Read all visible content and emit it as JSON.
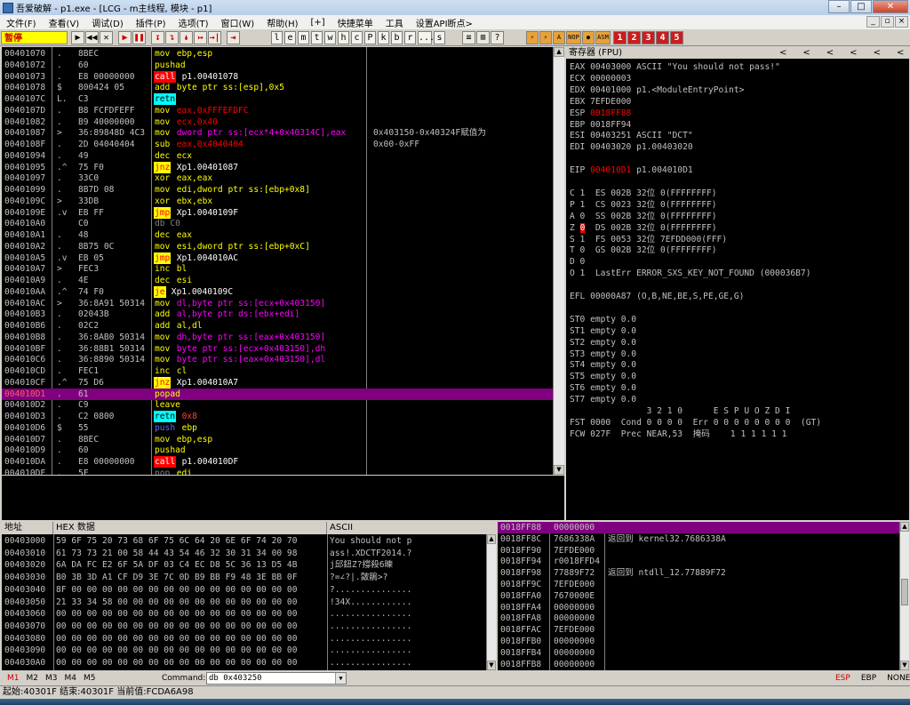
{
  "window": {
    "title": "吾爱破解 - p1.exe - [LCG - m主线程, 模块 - p1]",
    "btn_min": "–",
    "btn_max": "□",
    "btn_close": "✕"
  },
  "menu": {
    "items": [
      "文件(F)",
      "查看(V)",
      "调试(D)",
      "插件(P)",
      "选项(T)",
      "窗口(W)",
      "帮助(H)",
      "[+]",
      "快捷菜单",
      "工具",
      "设置API断点>"
    ],
    "mdi": [
      "_",
      "▫",
      "×"
    ]
  },
  "toolbar": {
    "status": "暂停",
    "buttons": [
      "▶",
      "◀◀",
      "✕",
      "▶",
      "❚❚",
      "↧",
      "↴",
      "↡",
      "↦",
      "→|",
      "⇥"
    ],
    "letters": [
      "l",
      "e",
      "m",
      "t",
      "w",
      "h",
      "c",
      "P",
      "k",
      "b",
      "r",
      "...",
      "s"
    ],
    "right_buttons": [
      "≡",
      "⊞",
      "?"
    ],
    "plugin_buttons": [
      "⚡",
      "⚡",
      "A",
      "NOP",
      "●",
      "ASM"
    ],
    "numbers": [
      "1",
      "2",
      "3",
      "4",
      "5"
    ]
  },
  "disasm": {
    "rows": [
      {
        "a": "00401070",
        "m": ".",
        "h": "8BEC",
        "i": "mov",
        "o": "ebp,esp",
        "ic": "norm",
        "oc": "norm",
        "c": ""
      },
      {
        "a": "00401072",
        "m": ".",
        "h": "60",
        "i": "pushad",
        "o": "",
        "ic": "norm",
        "oc": "norm",
        "c": ""
      },
      {
        "a": "00401073",
        "m": ".",
        "h": "E8 00000000",
        "i": "call",
        "o": "p1.00401078",
        "ic": "call",
        "oc": "norm",
        "c": ""
      },
      {
        "a": "00401078",
        "m": "$",
        "h": "800424 05",
        "i": "add",
        "o": "byte ptr ss:[esp],0x5",
        "ic": "norm",
        "oc": "norm",
        "c": ""
      },
      {
        "a": "0040107C",
        "m": "L.",
        "h": "C3",
        "i": "retn",
        "o": "",
        "ic": "ret",
        "oc": "norm",
        "c": ""
      },
      {
        "a": "0040107D",
        "m": ".",
        "h": "B8 FCFDFEFF",
        "i": "mov",
        "o": "eax,0xFFFEFDFC",
        "ic": "norm",
        "oc": "hex",
        "c": ""
      },
      {
        "a": "00401082",
        "m": ".",
        "h": "B9 40000000",
        "i": "mov",
        "o": "ecx,0x40",
        "ic": "norm",
        "oc": "hex",
        "c": ""
      },
      {
        "a": "00401087",
        "m": ">",
        "h": "36:89848D 4C3",
        "i": "mov",
        "o": "dword ptr ss:[ecx*4+0x40314C],eax",
        "ic": "norm",
        "oc": "mem",
        "c": "0x403150-0x40324F赋值为"
      },
      {
        "a": "0040108F",
        "m": ".",
        "h": "2D 04040404",
        "i": "sub",
        "o": "eax,0x4040404",
        "ic": "norm",
        "oc": "hex",
        "c": "0x00-0xFF"
      },
      {
        "a": "00401094",
        "m": ".",
        "h": "49",
        "i": "dec",
        "o": "ecx",
        "ic": "norm",
        "oc": "norm",
        "c": ""
      },
      {
        "a": "00401095",
        "m": ".^",
        "h": "75 F0",
        "i": "jnz",
        "o": "Xp1.00401087",
        "ic": "jcc",
        "oc": "norm",
        "c": ""
      },
      {
        "a": "00401097",
        "m": ".",
        "h": "33C0",
        "i": "xor",
        "o": "eax,eax",
        "ic": "norm",
        "oc": "norm",
        "c": ""
      },
      {
        "a": "00401099",
        "m": ".",
        "h": "8B7D 08",
        "i": "mov",
        "o": "edi,dword ptr ss:[ebp+0x8]",
        "ic": "norm",
        "oc": "norm",
        "c": ""
      },
      {
        "a": "0040109C",
        "m": ">",
        "h": "33DB",
        "i": "xor",
        "o": "ebx,ebx",
        "ic": "norm",
        "oc": "norm",
        "c": ""
      },
      {
        "a": "0040109E",
        "m": ".v",
        "h": "EB FF",
        "i": "jmp",
        "o": "Xp1.0040109F",
        "ic": "jmp",
        "oc": "norm",
        "c": ""
      },
      {
        "a": "004010A0",
        "m": "",
        "h": "C0",
        "i": "db C0",
        "o": "",
        "ic": "nop",
        "oc": "norm",
        "c": ""
      },
      {
        "a": "004010A1",
        "m": ".",
        "h": "48",
        "i": "dec",
        "o": "eax",
        "ic": "norm",
        "oc": "norm",
        "c": ""
      },
      {
        "a": "004010A2",
        "m": ".",
        "h": "8B75 0C",
        "i": "mov",
        "o": "esi,dword ptr ss:[ebp+0xC]",
        "ic": "norm",
        "oc": "norm",
        "c": ""
      },
      {
        "a": "004010A5",
        "m": ".v",
        "h": "EB 05",
        "i": "jmp",
        "o": "Xp1.004010AC",
        "ic": "jmp",
        "oc": "norm",
        "c": ""
      },
      {
        "a": "004010A7",
        "m": ">",
        "h": "FEC3",
        "i": "inc",
        "o": "bl",
        "ic": "norm",
        "oc": "norm",
        "c": ""
      },
      {
        "a": "004010A9",
        "m": ".",
        "h": "4E",
        "i": "dec",
        "o": "esi",
        "ic": "norm",
        "oc": "norm",
        "c": ""
      },
      {
        "a": "004010AA",
        "m": ".^",
        "h": "74 F0",
        "i": "je",
        "o": "Xp1.0040109C",
        "ic": "jcc",
        "oc": "norm",
        "c": ""
      },
      {
        "a": "004010AC",
        "m": ">",
        "h": "36:8A91 50314",
        "i": "mov",
        "o": "dl,byte ptr ss:[ecx+0x403150]",
        "ic": "norm",
        "oc": "mem",
        "c": ""
      },
      {
        "a": "004010B3",
        "m": ".",
        "h": "02043B",
        "i": "add",
        "o": "al,byte ptr ds:[ebx+edi]",
        "ic": "norm",
        "oc": "mem",
        "c": ""
      },
      {
        "a": "004010B6",
        "m": ".",
        "h": "02C2",
        "i": "add",
        "o": "al,dl",
        "ic": "norm",
        "oc": "norm",
        "c": ""
      },
      {
        "a": "004010B8",
        "m": ".",
        "h": "36:8AB0 50314",
        "i": "mov",
        "o": "dh,byte ptr ss:[eax+0x403150]",
        "ic": "norm",
        "oc": "mem",
        "c": ""
      },
      {
        "a": "004010BF",
        "m": ".",
        "h": "36:88B1 50314",
        "i": "mov",
        "o": "byte ptr ss:[ecx+0x403150],dh",
        "ic": "norm",
        "oc": "mem",
        "c": ""
      },
      {
        "a": "004010C6",
        "m": ".",
        "h": "36:8890 50314",
        "i": "mov",
        "o": "byte ptr ss:[eax+0x403150],dl",
        "ic": "norm",
        "oc": "mem",
        "c": ""
      },
      {
        "a": "004010CD",
        "m": ".",
        "h": "FEC1",
        "i": "inc",
        "o": "cl",
        "ic": "norm",
        "oc": "norm",
        "c": ""
      },
      {
        "a": "004010CF",
        "m": ".^",
        "h": "75 D6",
        "i": "jnz",
        "o": "Xp1.004010A7",
        "ic": "jcc",
        "oc": "norm",
        "c": ""
      },
      {
        "a": "004010D1",
        "m": ".",
        "h": "61",
        "i": "popad",
        "o": "",
        "ic": "norm",
        "oc": "norm",
        "c": "",
        "sel": true
      },
      {
        "a": "004010D2",
        "m": ".",
        "h": "C9",
        "i": "leave",
        "o": "",
        "ic": "norm",
        "oc": "norm",
        "c": ""
      },
      {
        "a": "004010D3",
        "m": ".",
        "h": "C2 0800",
        "i": "retn",
        "o": "0x8",
        "ic": "ret",
        "oc": "hex",
        "c": ""
      },
      {
        "a": "004010D6",
        "m": "$",
        "h": "55",
        "i": "push",
        "o": "ebp",
        "ic": "push",
        "oc": "norm",
        "c": ""
      },
      {
        "a": "004010D7",
        "m": ".",
        "h": "8BEC",
        "i": "mov",
        "o": "ebp,esp",
        "ic": "norm",
        "oc": "norm",
        "c": ""
      },
      {
        "a": "004010D9",
        "m": ".",
        "h": "60",
        "i": "pushad",
        "o": "",
        "ic": "norm",
        "oc": "norm",
        "c": ""
      },
      {
        "a": "004010DA",
        "m": ".",
        "h": "E8 00000000",
        "i": "call",
        "o": "p1.004010DF",
        "ic": "call",
        "oc": "norm",
        "c": ""
      },
      {
        "a": "004010DF",
        "m": ".",
        "h": "5F",
        "i": "pop",
        "o": "edi",
        "ic": "nop",
        "oc": "norm",
        "c": ""
      }
    ]
  },
  "registers": {
    "header": "寄存器 (FPU)",
    "arrows": [
      "<",
      "<",
      "<",
      "<",
      "<",
      "<"
    ],
    "lines": [
      {
        "t": "EAX 00403000 ASCII \"You should not pass!\"",
        "c": ""
      },
      {
        "t": "ECX 00000003",
        "c": ""
      },
      {
        "t": "EDX 00401000 p1.<ModuleEntryPoint>",
        "c": ""
      },
      {
        "t": "EBX 7EFDE000",
        "c": ""
      },
      {
        "t": "ESP 0018FF88",
        "c": "red"
      },
      {
        "t": "EBP 0018FF94",
        "c": ""
      },
      {
        "t": "ESI 00403251 ASCII \"DCT\"",
        "c": ""
      },
      {
        "t": "EDI 00403020 p1.00403020",
        "c": ""
      },
      {
        "t": "",
        "c": ""
      },
      {
        "t": "EIP 004010D1 p1.004010D1",
        "c": "eip"
      },
      {
        "t": "",
        "c": ""
      },
      {
        "t": "C 1  ES 002B 32位 0(FFFFFFFF)",
        "c": ""
      },
      {
        "t": "P 1  CS 0023 32位 0(FFFFFFFF)",
        "c": ""
      },
      {
        "t": "A 0  SS 002B 32位 0(FFFFFFFF)",
        "c": ""
      },
      {
        "t": "Z 0  DS 002B 32位 0(FFFFFFFF)",
        "c": "z"
      },
      {
        "t": "S 1  FS 0053 32位 7EFDD000(FFF)",
        "c": ""
      },
      {
        "t": "T 0  GS 002B 32位 0(FFFFFFFF)",
        "c": ""
      },
      {
        "t": "D 0",
        "c": ""
      },
      {
        "t": "O 1  LastErr ERROR_SXS_KEY_NOT_FOUND (000036B7)",
        "c": ""
      },
      {
        "t": "",
        "c": ""
      },
      {
        "t": "EFL 00000A87 (O,B,NE,BE,S,PE,GE,G)",
        "c": ""
      },
      {
        "t": "",
        "c": ""
      },
      {
        "t": "ST0 empty 0.0",
        "c": ""
      },
      {
        "t": "ST1 empty 0.0",
        "c": ""
      },
      {
        "t": "ST2 empty 0.0",
        "c": ""
      },
      {
        "t": "ST3 empty 0.0",
        "c": ""
      },
      {
        "t": "ST4 empty 0.0",
        "c": ""
      },
      {
        "t": "ST5 empty 0.0",
        "c": ""
      },
      {
        "t": "ST6 empty 0.0",
        "c": ""
      },
      {
        "t": "ST7 empty 0.0",
        "c": ""
      },
      {
        "t": "               3 2 1 0      E S P U O Z D I",
        "c": ""
      },
      {
        "t": "FST 0000  Cond 0 0 0 0  Err 0 0 0 0 0 0 0 0  (GT)",
        "c": ""
      },
      {
        "t": "FCW 027F  Prec NEAR,53  掩码    1 1 1 1 1 1",
        "c": ""
      }
    ]
  },
  "dump": {
    "col_addr": "地址",
    "col_hex": "HEX 数据",
    "col_ascii": "ASCII",
    "rows": [
      {
        "a": "00403000",
        "h": "59 6F 75 20 73 68 6F 75 6C 64 20 6E 6F 74 20 70",
        "s": "You should not p"
      },
      {
        "a": "00403010",
        "h": "61 73 73 21 00 58 44 43 54 46 32 30 31 34 00 98",
        "s": "ass!.XDCTF2014.?"
      },
      {
        "a": "00403020",
        "h": "6A DA FC E2 6F 5A DF 03 C4 EC D8 5C 36 13 D5 4B",
        "s": "j邱鈕Z?撐殺6暕"
      },
      {
        "a": "00403030",
        "h": "B0 3B 3D A1 CF D9 3E 7C 0D B9 BB F9 48 3E BB 0F",
        "s": "?=∠?|.皼鵑>?"
      },
      {
        "a": "00403040",
        "h": "8F 00 00 00 00 00 00 00 00 00 00 00 00 00 00 00",
        "s": "?..............."
      },
      {
        "a": "00403050",
        "h": "21 33 34 58 00 00 00 00 00 00 00 00 00 00 00 00",
        "s": "!34X............"
      },
      {
        "a": "00403060",
        "h": "00 00 00 00 00 00 00 00 00 00 00 00 00 00 00 00",
        "s": "................"
      },
      {
        "a": "00403070",
        "h": "00 00 00 00 00 00 00 00 00 00 00 00 00 00 00 00",
        "s": "................"
      },
      {
        "a": "00403080",
        "h": "00 00 00 00 00 00 00 00 00 00 00 00 00 00 00 00",
        "s": "................"
      },
      {
        "a": "00403090",
        "h": "00 00 00 00 00 00 00 00 00 00 00 00 00 00 00 00",
        "s": "................"
      },
      {
        "a": "004030A0",
        "h": "00 00 00 00 00 00 00 00 00 00 00 00 00 00 00 00",
        "s": "................"
      }
    ]
  },
  "stack": {
    "rows": [
      {
        "a": "0018FF88",
        "v": "00000000",
        "c": "",
        "sel": true
      },
      {
        "a": "0018FF8C",
        "v": "7686338A",
        "c": "返回到 kernel32.7686338A"
      },
      {
        "a": "0018FF90",
        "v": "7EFDE000",
        "c": ""
      },
      {
        "a": "0018FF94",
        "v": "r0018FFD4",
        "c": ""
      },
      {
        "a": "0018FF98",
        "v": "77889F72",
        "c": "返回到 ntdll_12.77889F72"
      },
      {
        "a": "0018FF9C",
        "v": "7EFDE000",
        "c": ""
      },
      {
        "a": "0018FFA0",
        "v": "7670000E",
        "c": ""
      },
      {
        "a": "0018FFA4",
        "v": "00000000",
        "c": ""
      },
      {
        "a": "0018FFA8",
        "v": "00000000",
        "c": ""
      },
      {
        "a": "0018FFAC",
        "v": "7EFDE000",
        "c": ""
      },
      {
        "a": "0018FFB0",
        "v": "00000000",
        "c": ""
      },
      {
        "a": "0018FFB4",
        "v": "00000000",
        "c": ""
      },
      {
        "a": "0018FFB8",
        "v": "00000000",
        "c": ""
      }
    ]
  },
  "command": {
    "tabs": [
      "M1",
      "M2",
      "M3",
      "M4",
      "M5"
    ],
    "label": "Command:",
    "value": "db 0x403250",
    "right": [
      "ESP",
      "EBP",
      "NONE"
    ]
  },
  "status": {
    "text": "起始:40301F 结束:40301F 当前值:FCDA6A98"
  }
}
